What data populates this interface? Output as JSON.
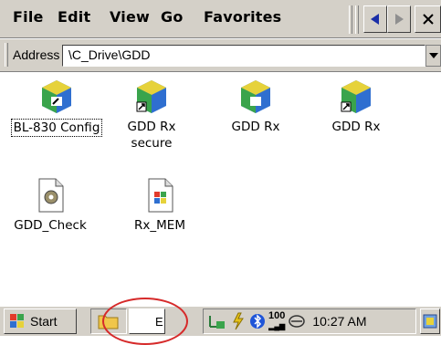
{
  "menu": {
    "file": "File",
    "edit": "Edit",
    "view": "View",
    "go": "Go",
    "favorites": "Favorites"
  },
  "address": {
    "label": "Address",
    "value": "\\C_Drive\\GDD"
  },
  "files": [
    {
      "label": "BL-830 Config",
      "icon": "app-shortcut-icon"
    },
    {
      "label": "GDD Rx\nsecure",
      "icon": "app-shortcut-icon"
    },
    {
      "label": "GDD Rx",
      "icon": "app-icon"
    },
    {
      "label": "GDD Rx",
      "icon": "app-shortcut-icon"
    },
    {
      "label": "GDD_Check",
      "icon": "gear-document-icon"
    },
    {
      "label": "Rx_MEM",
      "icon": "window-document-icon"
    }
  ],
  "taskbar": {
    "start_label": "Start",
    "task_text": "E",
    "clock": "10:27 AM",
    "volume_label": "100"
  },
  "colors": {
    "annotation": "#d62a2a",
    "chrome": "#d4d0c8"
  }
}
